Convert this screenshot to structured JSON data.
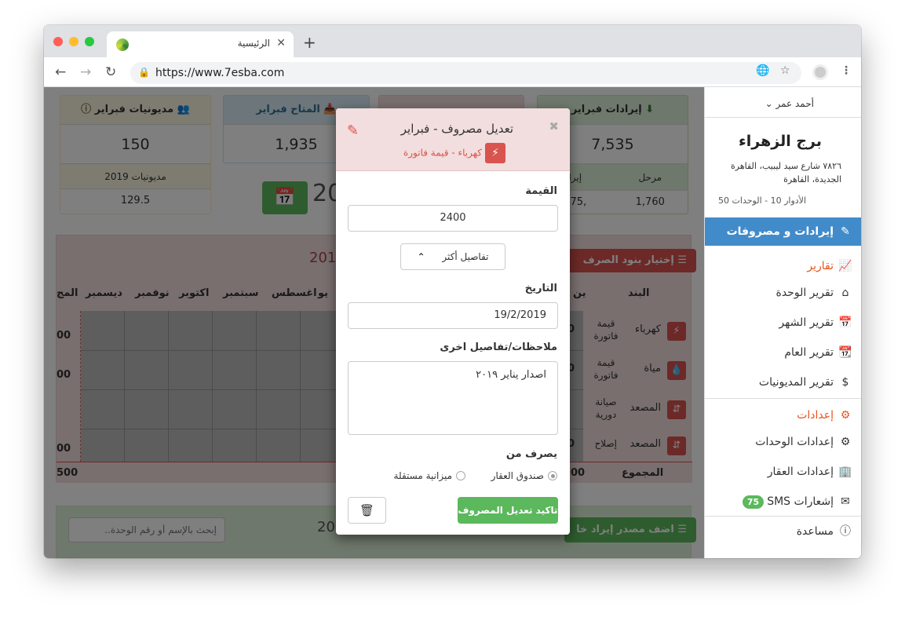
{
  "browser": {
    "tab_title": "الرئيسية",
    "url": "https://www.7esba.com",
    "close_glyph": "✕",
    "newtab_glyph": "+"
  },
  "sidebar": {
    "user_name": "أحمد عمر",
    "building_name": "برج الزهراء",
    "address": "٧٨٢٦ شارع سيد ليبيب، القاهرة الجديدة، القاهرة",
    "floors_units": "الأدوار 10 - الوحدات 50",
    "items": [
      {
        "label": "إيرادات و مصروفات",
        "icon": "edit-icon"
      },
      {
        "label": "تقارير",
        "icon": "chart-icon"
      },
      {
        "label": "تقرير الوحدة",
        "icon": "home-icon"
      },
      {
        "label": "تقرير الشهر",
        "icon": "calendar-icon"
      },
      {
        "label": "تقرير العام",
        "icon": "calendar-grid-icon"
      },
      {
        "label": "تقرير المديونيات",
        "icon": "dollar-icon"
      },
      {
        "label": "إعدادات",
        "icon": "gears-icon"
      },
      {
        "label": "إعدادات الوحدات",
        "icon": "gear-icon"
      },
      {
        "label": "إعدادات العقار",
        "icon": "building-icon"
      },
      {
        "label": "إشعارات SMS",
        "icon": "envelope-icon",
        "badge": "75"
      },
      {
        "label": "مساعدة",
        "icon": "help-icon"
      }
    ]
  },
  "cards": {
    "revenue": {
      "title": "إيرادات فبراير",
      "value": "7,535",
      "col_label": "مرحل",
      "col_value": "1,760",
      "col2_label": "إيرا",
      "col2_value": ",775"
    },
    "available": {
      "title": "المتاح فبراير",
      "value": "1,935"
    },
    "debts": {
      "title": "مديونيات فبراير",
      "value": "150",
      "sub_label": "مديونيات 2019",
      "sub_value": "129.5"
    },
    "year_fragment": "20"
  },
  "expense_table": {
    "choose_button": "إختيار بنود الصرف",
    "year": "201",
    "headers": [
      "البند",
      "ين",
      "يو",
      "اغسطس",
      "سبتمبر",
      "اكتوبر",
      "نوفمبر",
      "ديسمبر",
      "المج"
    ],
    "rows": [
      {
        "name": "كهرباء",
        "type": "قيمة فاتورة",
        "val": "00",
        "total": "00"
      },
      {
        "name": "مياة",
        "type": "قيمة فاتورة",
        "val": "00",
        "total": "00"
      },
      {
        "name": "المصعد",
        "type": "صيانة دورية",
        "val": "",
        "total": ""
      },
      {
        "name": "المصعد",
        "type": "إصلاح",
        "val": "00",
        "total": "00"
      }
    ],
    "total_label": "المجموع",
    "total_val": "00",
    "total_end": "500"
  },
  "bottom": {
    "add_revenue_button": "اضف مصدر إيراد خا",
    "search_placeholder": "إبحث بالإسم أو رقم الوحدة..",
    "year_fragment": "20"
  },
  "modal": {
    "title": "تعديل مصروف - فبراير",
    "subtitle": "كهرباء - قيمة فاتورة",
    "value_label": "القيمة",
    "value": "2400",
    "more_details": "تفاصيل أكثر",
    "date_label": "التاريخ",
    "date": "19/2/2019",
    "notes_label": "ملاحظات/تفاصيل اخرى",
    "notes": "اصدار يناير ٢٠١٩",
    "paid_from_label": "يصرف من",
    "option_1": "صندوق العقار",
    "option_2": "ميزانية مستقلة",
    "confirm_button": "تاكيد تعديل المصروف"
  }
}
